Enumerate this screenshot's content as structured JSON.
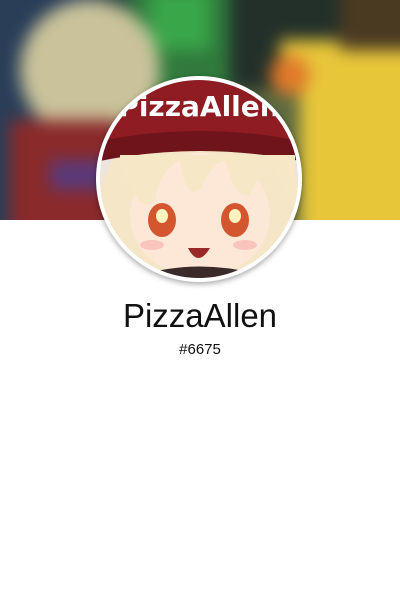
{
  "profile": {
    "username": "PizzaAllen",
    "tag": "#6675",
    "avatar_text": "PizzaAllen"
  },
  "banner": {
    "description_icon": "blurred-banner-image"
  },
  "colors": {
    "hat": "#8e1c22",
    "hair": "#f6e7c6",
    "eyes": "#d4562e",
    "background": "#ffffff"
  }
}
